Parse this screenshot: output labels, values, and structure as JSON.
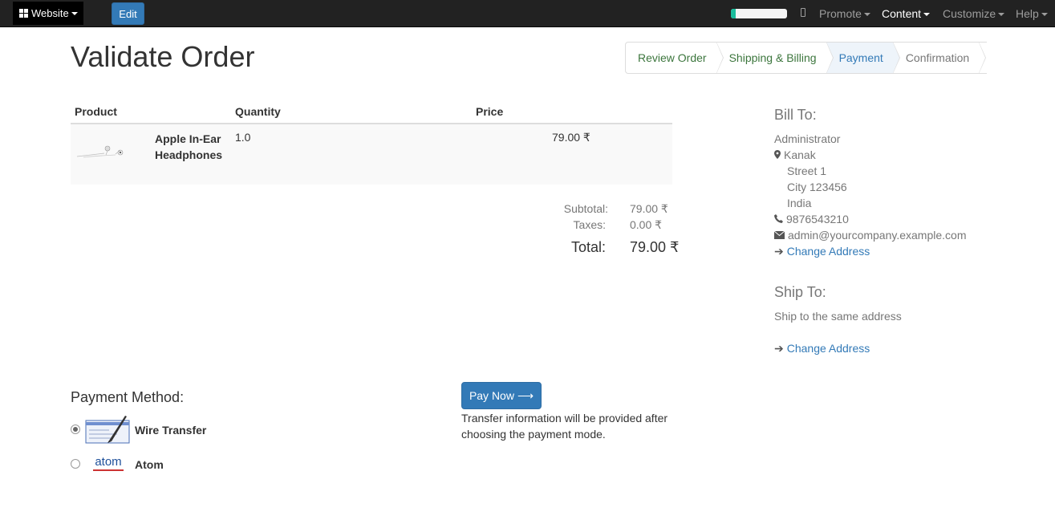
{
  "topbar": {
    "website_label": "Website",
    "edit_label": "Edit",
    "progress_fraction": 0.08,
    "nav": [
      "Promote",
      "Content",
      "Customize",
      "Help"
    ],
    "active_nav": "Content",
    "accent": "#337ab7",
    "progress_color": "#1abc9c"
  },
  "page": {
    "title": "Validate Order"
  },
  "wizard": [
    "Review Order",
    "Shipping & Billing",
    "Payment",
    "Confirmation"
  ],
  "cart": {
    "headers": {
      "product": "Product",
      "quantity": "Quantity",
      "price": "Price"
    },
    "lines": [
      {
        "name": "Apple In-Ear Headphones",
        "quantity": "1.0",
        "price": "79.00 ₹"
      }
    ],
    "subtotal_label": "Subtotal:",
    "subtotal": "79.00 ₹",
    "taxes_label": "Taxes:",
    "taxes": "0.00 ₹",
    "total_label": "Total:",
    "total": "79.00 ₹"
  },
  "bill_to": {
    "heading": "Bill To:",
    "name": "Administrator",
    "city_line": "Kanak",
    "street": "Street 1",
    "zip_line": "City 123456",
    "country": "India",
    "phone": "9876543210",
    "email": "admin@yourcompany.example.com",
    "change_label": "Change Address"
  },
  "ship_to": {
    "heading": "Ship To:",
    "text": "Ship to the same address",
    "change_label": "Change Address"
  },
  "payment": {
    "heading": "Payment Method:",
    "methods": [
      {
        "name": "Wire Transfer",
        "selected": true
      },
      {
        "name": "Atom",
        "selected": false
      }
    ],
    "atom_logo_text": "atom",
    "pay_label": "Pay Now",
    "info": "Transfer information will be provided after choosing the payment mode."
  }
}
